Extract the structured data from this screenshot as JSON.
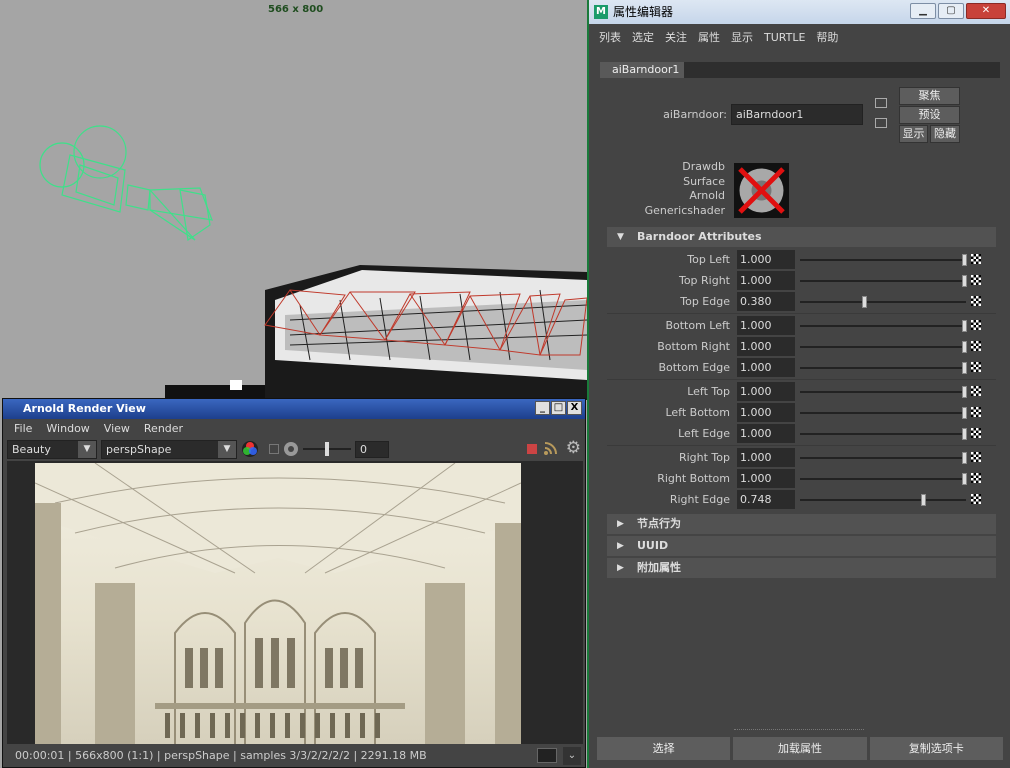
{
  "viewport": {
    "resolution_label": "566 x 800"
  },
  "render_view": {
    "title": "Arnold Render View",
    "window_buttons": [
      "_",
      "□",
      "X"
    ],
    "menu": [
      "File",
      "Window",
      "View",
      "Render"
    ],
    "aov_combo": "Beauty",
    "camera_combo": "perspShape",
    "exposure_value": "0",
    "status": "00:00:01 | 566x800 (1:1) | perspShape  | samples 3/3/2/2/2/2 | 2291.18 MB"
  },
  "attribute_editor": {
    "title": "属性编辑器",
    "menu": [
      "列表",
      "选定",
      "关注",
      "属性",
      "显示",
      "TURTLE",
      "帮助"
    ],
    "tab": "aiBarndoor1",
    "node_label": "aiBarndoor:",
    "node_name": "aiBarndoor1",
    "buttons": {
      "focus": "聚焦",
      "presets": "预设",
      "show": "显示",
      "hide": "隐藏"
    },
    "classification": [
      "Drawdb",
      "Surface",
      "Arnold",
      "Genericshader"
    ],
    "section_barndoor": "Barndoor Attributes",
    "attributes": [
      {
        "label": "Top Left",
        "value": "1.000",
        "level": 1.0
      },
      {
        "label": "Top Right",
        "value": "1.000",
        "level": 1.0
      },
      {
        "label": "Top Edge",
        "value": "0.380",
        "level": 0.38
      },
      {
        "label": "Bottom Left",
        "value": "1.000",
        "level": 1.0
      },
      {
        "label": "Bottom Right",
        "value": "1.000",
        "level": 1.0
      },
      {
        "label": "Bottom Edge",
        "value": "1.000",
        "level": 1.0
      },
      {
        "label": "Left Top",
        "value": "1.000",
        "level": 1.0
      },
      {
        "label": "Left Bottom",
        "value": "1.000",
        "level": 1.0
      },
      {
        "label": "Left Edge",
        "value": "1.000",
        "level": 1.0
      },
      {
        "label": "Right Top",
        "value": "1.000",
        "level": 1.0
      },
      {
        "label": "Right Bottom",
        "value": "1.000",
        "level": 1.0
      },
      {
        "label": "Right Edge",
        "value": "0.748",
        "level": 0.748
      }
    ],
    "collapsed_sections": [
      "节点行为",
      "UUID",
      "附加属性"
    ],
    "bottom_buttons": [
      "选择",
      "加载属性",
      "复制选项卡"
    ]
  }
}
